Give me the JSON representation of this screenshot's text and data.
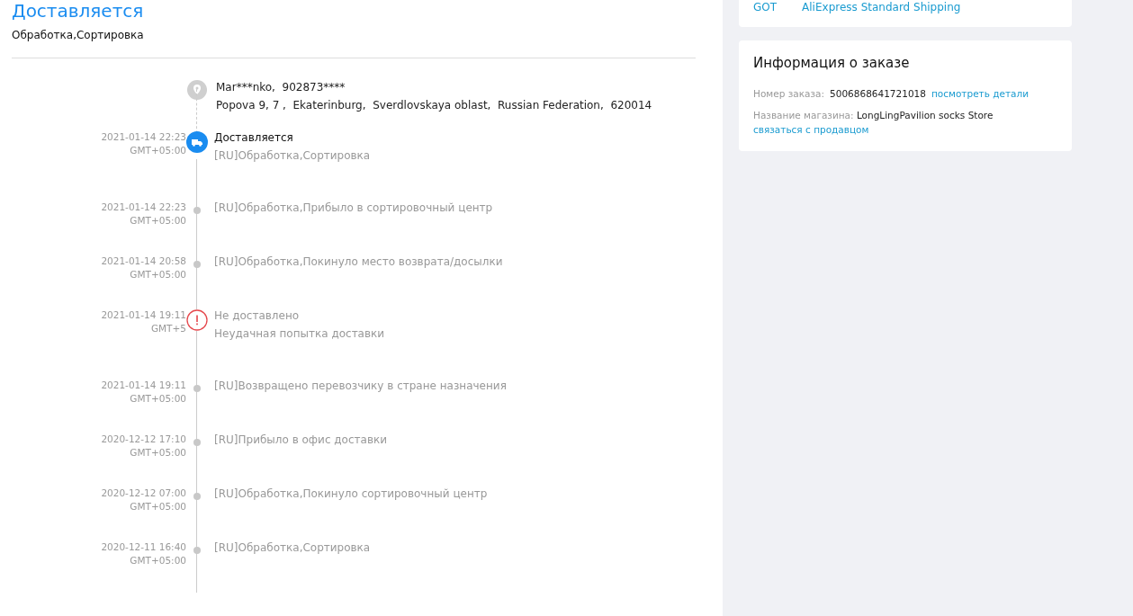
{
  "status": {
    "title": "Доставляется",
    "subtitle": "Обработка,Сортировка"
  },
  "address": {
    "name_line": "Mar***nko,  902873****",
    "address_line": "Popova 9, 7 ,  Ekaterinburg,  Sverdlovskaya oblast,  Russian Federation,  620014"
  },
  "events": [
    {
      "kind": "current",
      "date": "2021-01-14 22:23",
      "timezone": "GMT+05:00",
      "title": "Доставляется",
      "detail": "[RU]Обработка,Сортировка"
    },
    {
      "kind": "normal",
      "date": "2021-01-14 22:23",
      "timezone": "GMT+05:00",
      "detail": "[RU]Обработка,Прибыло в сортировочный центр"
    },
    {
      "kind": "normal",
      "date": "2021-01-14 20:58",
      "timezone": "GMT+05:00",
      "detail": "[RU]Обработка,Покинуло место возврата/досылки"
    },
    {
      "kind": "failed",
      "date": "2021-01-14 19:11",
      "timezone": "GMT+5",
      "title": "Не доставлено",
      "detail": "Неудачная попытка доставки"
    },
    {
      "kind": "normal",
      "date": "2021-01-14 19:11",
      "timezone": "GMT+05:00",
      "detail": "[RU]Возвращено перевозчику в стране назначения"
    },
    {
      "kind": "normal",
      "date": "2020-12-12 17:10",
      "timezone": "GMT+05:00",
      "detail": "[RU]Прибыло в офис доставки"
    },
    {
      "kind": "normal",
      "date": "2020-12-12 07:00",
      "timezone": "GMT+05:00",
      "detail": "[RU]Обработка,Покинуло сортировочный центр"
    },
    {
      "kind": "normal",
      "date": "2020-12-11 16:40",
      "timezone": "GMT+05:00",
      "detail": "[RU]Обработка,Сортировка"
    }
  ],
  "shipping": {
    "carrier": "GOT",
    "service": "AliExpress Standard Shipping"
  },
  "order_info": {
    "title": "Информация о заказе",
    "order_label": "Номер заказа:",
    "order_number": "5006868641721018",
    "details_link": "посмотреть детали",
    "store_label": "Название магазина:",
    "store_name": "LongLingPavilion socks Store",
    "contact_link": "связаться с продавцом"
  }
}
